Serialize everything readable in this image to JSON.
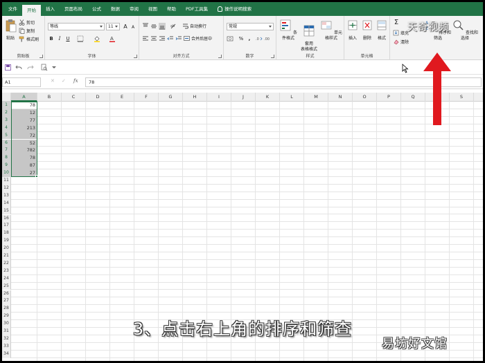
{
  "tabs": [
    "文件",
    "开始",
    "插入",
    "页面布局",
    "公式",
    "数据",
    "审阅",
    "视图",
    "帮助",
    "PDF工具集",
    "操作说明搜索"
  ],
  "active_tab": "开始",
  "ribbon": {
    "clipboard": {
      "label": "剪贴板",
      "paste": "粘贴",
      "cut": "剪切",
      "copy": "复制",
      "format_painter": "格式刷"
    },
    "font": {
      "label": "字体",
      "font_name": "等线",
      "font_size": "11",
      "bold": "B",
      "italic": "I",
      "underline": "U",
      "grow": "A",
      "shrink": "A"
    },
    "alignment": {
      "label": "对齐方式",
      "wrap": "自动换行",
      "merge": "合并后居中"
    },
    "number": {
      "label": "数字",
      "format": "常规",
      "percent": "%",
      "comma": ","
    },
    "styles": {
      "label": "样式",
      "conditional": "条件格式",
      "table": "套用\n表格格式",
      "cell_styles": "单元格样式"
    },
    "cells": {
      "label": "单元格",
      "insert": "插入",
      "delete": "删除",
      "format": "格式"
    },
    "editing": {
      "sum": "Σ",
      "fill": "填充",
      "clear": "清除",
      "sort_filter": "排序和筛选",
      "find_select": "查找和选择"
    }
  },
  "formula_bar": {
    "name_box": "A1",
    "cancel": "✕",
    "enter": "✓",
    "fx": "fx",
    "value": "78"
  },
  "columns": [
    "A",
    "B",
    "C",
    "D",
    "E",
    "F",
    "G",
    "H",
    "I",
    "J",
    "K",
    "L",
    "M",
    "N",
    "O",
    "P",
    "Q",
    "R",
    "S"
  ],
  "rows": [
    "1",
    "2",
    "3",
    "4",
    "5",
    "6",
    "7",
    "8",
    "9",
    "10",
    "11",
    "12",
    "13",
    "14",
    "15",
    "16",
    "17",
    "18",
    "19",
    "20",
    "21",
    "22",
    "23",
    "24",
    "25",
    "26",
    "27",
    "28",
    "29",
    "30",
    "31",
    "32",
    "33",
    "34"
  ],
  "column_a_values": [
    "78",
    "12",
    "77",
    "213",
    "72",
    "52",
    "782",
    "78",
    "87",
    "27"
  ],
  "caption": "3、点击右上角的排序和筛查",
  "watermark_top": "天奇视频",
  "watermark_bottom": "易坊好文馆",
  "colors": {
    "excel_green": "#217346",
    "arrow_red": "#e0191f",
    "selection": "#c6c6c6"
  }
}
